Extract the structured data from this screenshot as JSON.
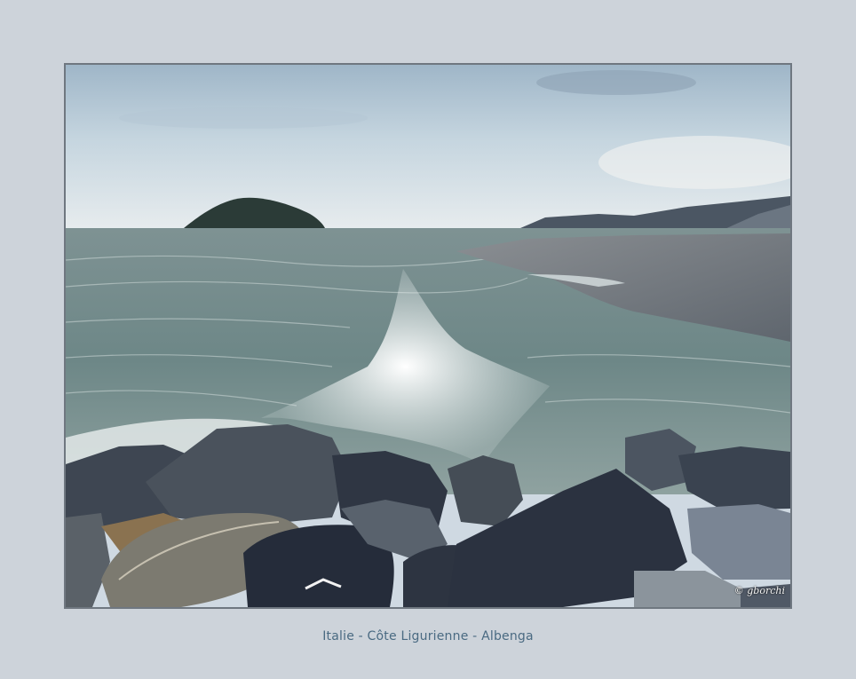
{
  "caption": "Italie - Côte Ligurienne - Albenga",
  "watermark": "© gborchi",
  "photo": {
    "subject": "seascape-island-waves-rocks",
    "colors": {
      "frame_bg": "#cdd3da",
      "sky_top": "#a9bfd0",
      "sky_horizon": "#e9eef0",
      "sea": "#6f8a8c",
      "foam": "#eef2f2",
      "rock": "#3c4452",
      "island": "#2b3b37"
    }
  }
}
